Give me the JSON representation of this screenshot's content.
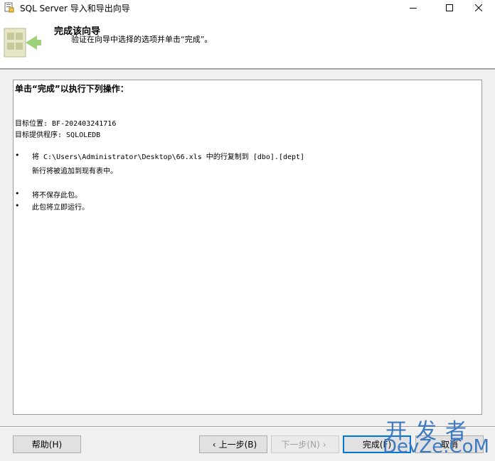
{
  "window": {
    "title": "SQL Server 导入和导出向导"
  },
  "header": {
    "title": "完成该向导",
    "subtitle": "验证在向导中选择的选项并单击“完成”。"
  },
  "report": {
    "heading": "单击“完成”以执行下列操作：",
    "target_location": "目标位置: BF-202403241716",
    "target_provider": "目标提供程序: SQLOLEDB",
    "bullets": [
      {
        "symbol": "•",
        "line1": "将 C:\\Users\\Administrator\\Desktop\\66.xls 中的行复制到 [dbo].[dept]",
        "line2": "新行将被追加到现有表中。"
      },
      {
        "symbol": "•",
        "line1": "将不保存此包。"
      },
      {
        "symbol": "•",
        "line1": "此包将立即运行。"
      }
    ]
  },
  "buttons": {
    "help": "帮助(H)",
    "back": "上一步(B)",
    "next": "下一步(N)",
    "finish": "完成(F)",
    "cancel": "取消"
  },
  "watermark": {
    "top": "开发者",
    "bottom": "DevZe.CoM"
  },
  "colors": {
    "accent": "#0078d7",
    "watermark": "#3f7ac0"
  }
}
